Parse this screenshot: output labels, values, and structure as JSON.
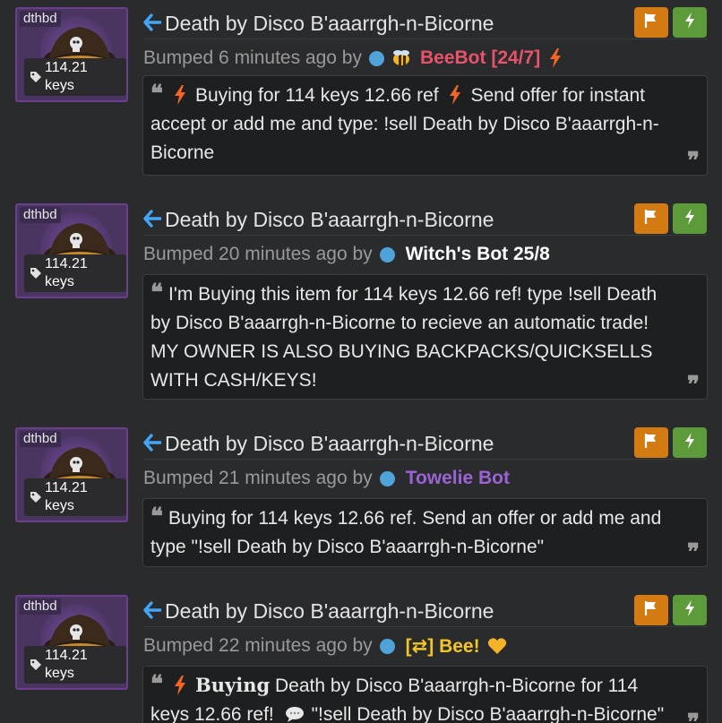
{
  "colors": {
    "page_bg": "#2a2b2d",
    "accent_arrow": "#42a5f5",
    "flag_button": "#d37b12",
    "bolt_button": "#5d9a3a",
    "status_dot": "#4fa3d9",
    "beebot_name": "#e8536a",
    "witch_name": "#ffffff",
    "towelie_name": "#9b63d6",
    "bee_name": "#f3c623",
    "bolt_orange": "#f26522",
    "item_frame": "#6d3d8f"
  },
  "listings": [
    {
      "thumb_tag": "dthbd",
      "price": "114.21 keys",
      "title": "Death by Disco B'aaarrgh-n-Bicorne",
      "bumped_prefix": "Bumped 6 minutes ago by",
      "user": "BeeBot [24/7]",
      "user_color": "#e8536a",
      "user_badges": [
        "bee-icon",
        "lightning-icon"
      ],
      "message": {
        "parts": [
          {
            "type": "bolt"
          },
          {
            "type": "text",
            "text": "Buying for 114 keys 12.66 ref"
          },
          {
            "type": "bolt"
          },
          {
            "type": "text",
            "text": "Send offer for instant accept or add me and type: !sell Death by Disco B'aaarrgh-n-Bicorne"
          }
        ]
      }
    },
    {
      "thumb_tag": "dthbd",
      "price": "114.21 keys",
      "title": "Death by Disco B'aaarrgh-n-Bicorne",
      "bumped_prefix": "Bumped 20 minutes ago by",
      "user": "Witch's Bot 25/8",
      "user_color": "#ffffff",
      "user_badges": [],
      "message": {
        "parts": [
          {
            "type": "text",
            "text": "I'm Buying this item for 114 keys 12.66 ref! type !sell Death by Disco B'aaarrgh-n-Bicorne to recieve an automatic trade! MY OWNER IS ALSO BUYING BACKPACKS/QUICKSELLS WITH CASH/KEYS!"
          }
        ]
      }
    },
    {
      "thumb_tag": "dthbd",
      "price": "114.21 keys",
      "title": "Death by Disco B'aaarrgh-n-Bicorne",
      "bumped_prefix": "Bumped 21 minutes ago by",
      "user": "Towelie Bot",
      "user_color": "#9b63d6",
      "user_badges": [],
      "message": {
        "parts": [
          {
            "type": "text",
            "text": "Buying for 114 keys 12.66 ref. Send an offer or add me and type \"!sell Death by Disco B'aaarrgh-n-Bicorne\""
          }
        ]
      }
    },
    {
      "thumb_tag": "dthbd",
      "price": "114.21 keys",
      "title": "Death by Disco B'aaarrgh-n-Bicorne",
      "bumped_prefix": "Bumped 22 minutes ago by",
      "user": "[⇄] Bee!",
      "user_color": "#f3c623",
      "user_badges": [
        "yellow-heart-icon"
      ],
      "message": {
        "parts": [
          {
            "type": "bolt"
          },
          {
            "type": "serif",
            "text": "Buying"
          },
          {
            "type": "text",
            "text": "Death by Disco B'aaarrgh-n-Bicorne for 114 keys 12.66 ref!"
          },
          {
            "type": "speech"
          },
          {
            "type": "text",
            "text": "\"!sell Death by Disco B'aaarrgh-n-Bicorne\""
          }
        ]
      }
    }
  ]
}
